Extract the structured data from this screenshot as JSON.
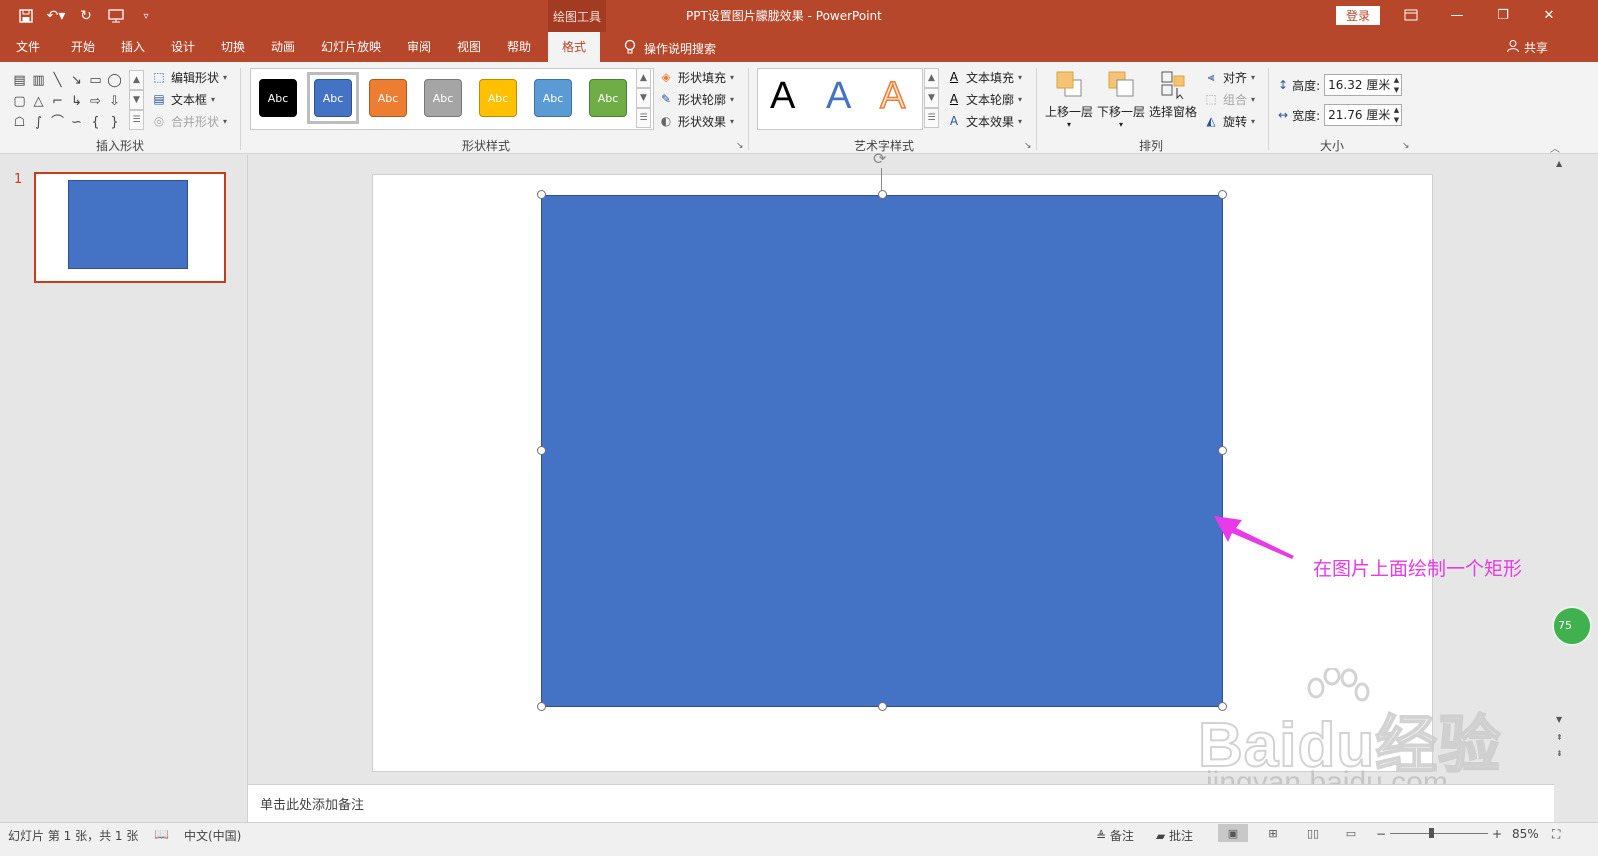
{
  "app": {
    "title": "PPT设置图片朦胧效果  -  PowerPoint",
    "context_tool": "绘图工具",
    "login_label": "登录",
    "share_label": "共享"
  },
  "quick_access": [
    "save-icon",
    "undo-icon",
    "redo-icon",
    "present-icon",
    "customize-icon"
  ],
  "tabs": [
    {
      "label": "文件"
    },
    {
      "label": "开始"
    },
    {
      "label": "插入"
    },
    {
      "label": "设计"
    },
    {
      "label": "切换"
    },
    {
      "label": "动画"
    },
    {
      "label": "幻灯片放映"
    },
    {
      "label": "审阅"
    },
    {
      "label": "视图"
    },
    {
      "label": "帮助"
    },
    {
      "label": "格式",
      "active": true
    }
  ],
  "tell_me": "操作说明搜索",
  "ribbon": {
    "insert_shapes": {
      "label": "插入形状",
      "edit_shape": "编辑形状",
      "text_box": "文本框",
      "merge_shapes": "合并形状"
    },
    "shape_styles": {
      "label": "形状样式",
      "swatch_text": "Abc",
      "swatches": [
        {
          "color": "#000000",
          "border": "#000000"
        },
        {
          "color": "#4472c4",
          "border": "#2f528f",
          "selected": true
        },
        {
          "color": "#ed7d31",
          "border": "#ae5a21"
        },
        {
          "color": "#a5a5a5",
          "border": "#787878"
        },
        {
          "color": "#ffc000",
          "border": "#bc8c00"
        },
        {
          "color": "#5b9bd5",
          "border": "#41719c"
        },
        {
          "color": "#70ad47",
          "border": "#507e32"
        }
      ],
      "fill": "形状填充",
      "outline": "形状轮廓",
      "effects": "形状效果"
    },
    "wordart_styles": {
      "label": "艺术字样式",
      "samples": [
        "A",
        "A",
        "A"
      ],
      "text_fill": "文本填充",
      "text_outline": "文本轮廓",
      "text_effects": "文本效果"
    },
    "arrange": {
      "label": "排列",
      "bring_forward": "上移一层",
      "send_backward": "下移一层",
      "selection_pane": "选择窗格",
      "align": "对齐",
      "group": "组合",
      "rotate": "旋转"
    },
    "size": {
      "label": "大小",
      "height_label": "高度:",
      "height_value": "16.32 厘米",
      "width_label": "宽度:",
      "width_value": "21.76 厘米"
    }
  },
  "thumbnail": {
    "number": "1"
  },
  "slide": {
    "shape_color": "#4472c4"
  },
  "annotation": "在图片上面绘制一个矩形",
  "badge_text": "75",
  "watermark": {
    "brand": "Baidu经验",
    "url": "jingyan.baidu.com"
  },
  "notes_placeholder": "单击此处添加备注",
  "status": {
    "slide_info": "幻灯片 第 1 张，共 1 张",
    "language": "中文(中国)",
    "notes": "备注",
    "comments": "批注",
    "zoom": "85%"
  }
}
